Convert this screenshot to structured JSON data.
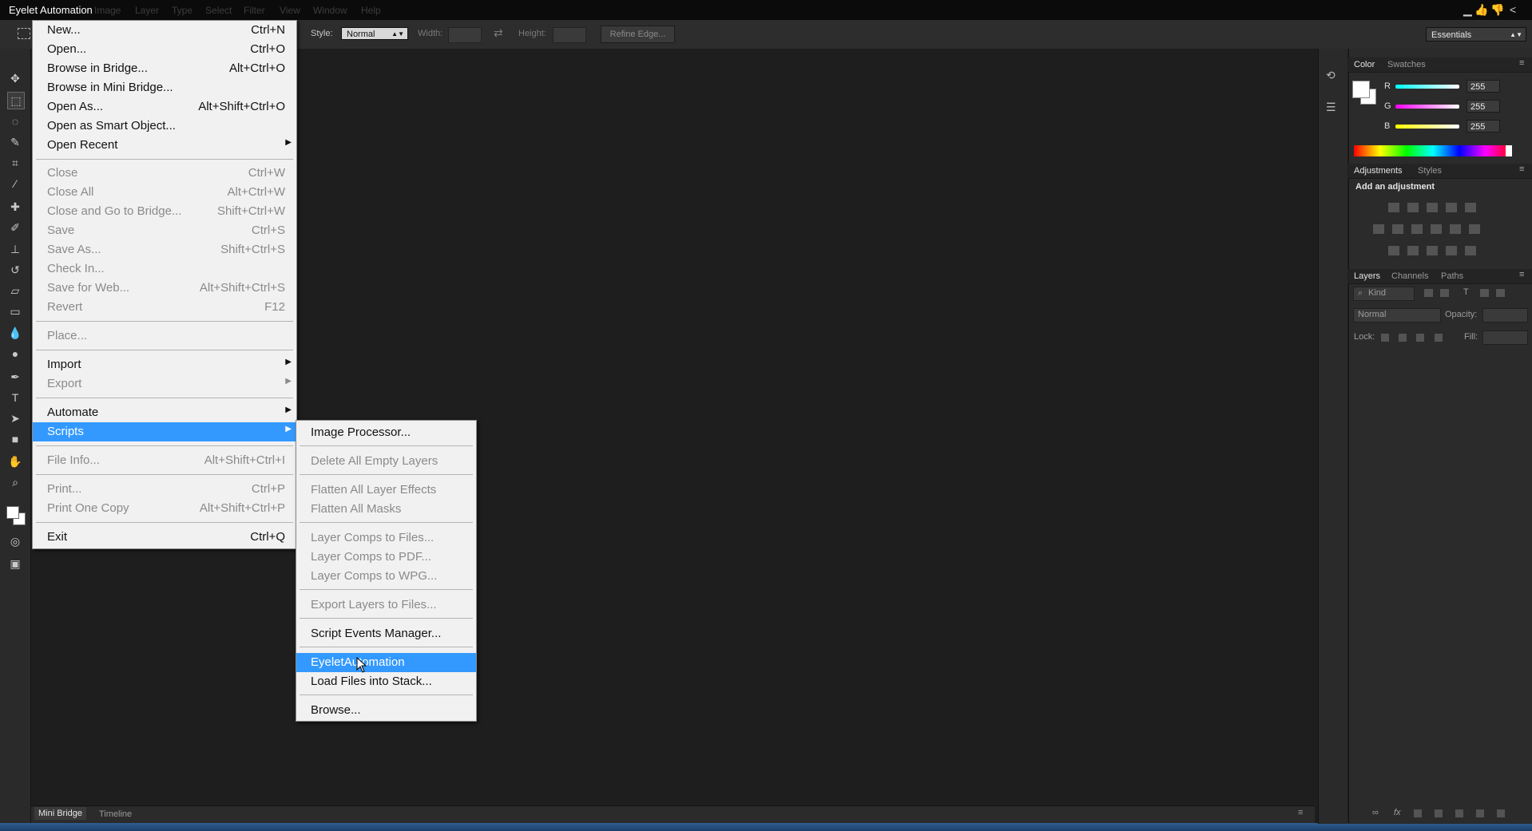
{
  "app": {
    "title": "Eyelet Automation"
  },
  "menubar": {
    "items": [
      "Image",
      "Layer",
      "Type",
      "Select",
      "Filter",
      "View",
      "Window",
      "Help"
    ]
  },
  "options_bar": {
    "style_label": "Style:",
    "style_value": "Normal",
    "width_label": "Width:",
    "height_label": "Height:",
    "refine_edge": "Refine Edge...",
    "workspace": "Essentials"
  },
  "file_menu": {
    "items": [
      {
        "label": "New...",
        "shortcut": "Ctrl+N"
      },
      {
        "label": "Open...",
        "shortcut": "Ctrl+O"
      },
      {
        "label": "Browse in Bridge...",
        "shortcut": "Alt+Ctrl+O"
      },
      {
        "label": "Browse in Mini Bridge...",
        "shortcut": ""
      },
      {
        "label": "Open As...",
        "shortcut": "Alt+Shift+Ctrl+O"
      },
      {
        "label": "Open as Smart Object...",
        "shortcut": ""
      },
      {
        "label": "Open Recent",
        "shortcut": ""
      },
      {
        "label": "Close",
        "shortcut": "Ctrl+W"
      },
      {
        "label": "Close All",
        "shortcut": "Alt+Ctrl+W"
      },
      {
        "label": "Close and Go to Bridge...",
        "shortcut": "Shift+Ctrl+W"
      },
      {
        "label": "Save",
        "shortcut": "Ctrl+S"
      },
      {
        "label": "Save As...",
        "shortcut": "Shift+Ctrl+S"
      },
      {
        "label": "Check In...",
        "shortcut": ""
      },
      {
        "label": "Save for Web...",
        "shortcut": "Alt+Shift+Ctrl+S"
      },
      {
        "label": "Revert",
        "shortcut": "F12"
      },
      {
        "label": "Place...",
        "shortcut": ""
      },
      {
        "label": "Import",
        "shortcut": ""
      },
      {
        "label": "Export",
        "shortcut": ""
      },
      {
        "label": "Automate",
        "shortcut": ""
      },
      {
        "label": "Scripts",
        "shortcut": ""
      },
      {
        "label": "File Info...",
        "shortcut": "Alt+Shift+Ctrl+I"
      },
      {
        "label": "Print...",
        "shortcut": "Ctrl+P"
      },
      {
        "label": "Print One Copy",
        "shortcut": "Alt+Shift+Ctrl+P"
      },
      {
        "label": "Exit",
        "shortcut": "Ctrl+Q"
      }
    ]
  },
  "scripts_menu": {
    "items": [
      "Image Processor...",
      "Delete All Empty Layers",
      "Flatten All Layer Effects",
      "Flatten All Masks",
      "Layer Comps to Files...",
      "Layer Comps to PDF...",
      "Layer Comps to WPG...",
      "Export Layers to Files...",
      "Script Events Manager...",
      "EyeletAutomation",
      "Load Files into Stack...",
      "Browse..."
    ]
  },
  "color_panel": {
    "tabs": [
      "Color",
      "Swatches"
    ],
    "channels": [
      {
        "name": "R",
        "value": "255"
      },
      {
        "name": "G",
        "value": "255"
      },
      {
        "name": "B",
        "value": "255"
      }
    ]
  },
  "adjustments_panel": {
    "tabs": [
      "Adjustments",
      "Styles"
    ],
    "hint": "Add an adjustment"
  },
  "layers_panel": {
    "tabs": [
      "Layers",
      "Channels",
      "Paths"
    ],
    "kind": "Kind",
    "blend_mode": "Normal",
    "opacity_label": "Opacity:",
    "lock_label": "Lock:",
    "fill_label": "Fill:"
  },
  "bottom_tabs": [
    "Mini Bridge",
    "Timeline"
  ],
  "colors": {
    "highlight": "#3399ff",
    "menu_bg": "#f1f1f1",
    "workspace_bg": "#1e1e1e"
  }
}
